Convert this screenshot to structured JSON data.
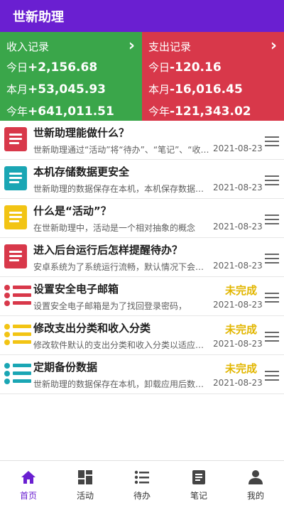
{
  "app": {
    "title": "世新助理"
  },
  "summary": {
    "income": {
      "title": "收入记录",
      "today_label": "今日",
      "today_value": "+2,156.68",
      "month_label": "本月",
      "month_value": "+53,045.93",
      "year_label": "今年",
      "year_value": "+641,011.51"
    },
    "expense": {
      "title": "支出记录",
      "today_label": "今日",
      "today_value": "-120.16",
      "month_label": "本月",
      "month_value": "-16,016.45",
      "year_label": "今年",
      "year_value": "-121,343.02"
    }
  },
  "list": [
    {
      "title": "世新助理能做什么？",
      "desc": "世新助理通过“活动”将“待办”、“笔记”、“收入”、“支出”串联",
      "date": "2021-08-23",
      "status": "",
      "icon": "note-icon",
      "color": "#d8384a"
    },
    {
      "title": "本机存储数据更安全",
      "desc": "世新助理的数据保存在本机，本机保存数据更安全",
      "date": "2021-08-23",
      "status": "",
      "icon": "note-icon",
      "color": "#1aa6b4"
    },
    {
      "title": "什么是“活动”？",
      "desc": "在世新助理中，活动是一个相对抽象的概念",
      "date": "2021-08-23",
      "status": "",
      "icon": "note-icon",
      "color": "#f2c414"
    },
    {
      "title": "进入后台运行后怎样提醒待办？",
      "desc": "安卓系统为了系统运行流畅，默认情况下会限制后台",
      "date": "2021-08-23",
      "status": "",
      "icon": "note-icon",
      "color": "#d8384a"
    },
    {
      "title": "设置安全电子邮箱",
      "desc": "设置安全电子邮箱是为了找回登录密码，",
      "date": "2021-08-23",
      "status": "未完成",
      "icon": "todo-icon",
      "color": "#d8384a"
    },
    {
      "title": "修改支出分类和收入分类",
      "desc": "修改软件默认的支出分类和收入分类以适应您的需要",
      "date": "2021-08-23",
      "status": "未完成",
      "icon": "todo-icon",
      "color": "#f2c414"
    },
    {
      "title": "定期备份数据",
      "desc": "世新助理的数据保存在本机，卸载应用后数据将丢失",
      "date": "2021-08-23",
      "status": "未完成",
      "icon": "todo-icon",
      "color": "#1aa6b4"
    }
  ],
  "tabs": [
    {
      "label": "首页",
      "icon": "home-icon",
      "active": true
    },
    {
      "label": "活动",
      "icon": "activity-icon",
      "active": false
    },
    {
      "label": "待办",
      "icon": "todo-list-icon",
      "active": false
    },
    {
      "label": "笔记",
      "icon": "note-icon",
      "active": false
    },
    {
      "label": "我的",
      "icon": "person-icon",
      "active": false
    }
  ],
  "colors": {
    "primary": "#6a1fd1",
    "income": "#3aa64a",
    "expense": "#d8384a",
    "pending": "#e2b600"
  }
}
